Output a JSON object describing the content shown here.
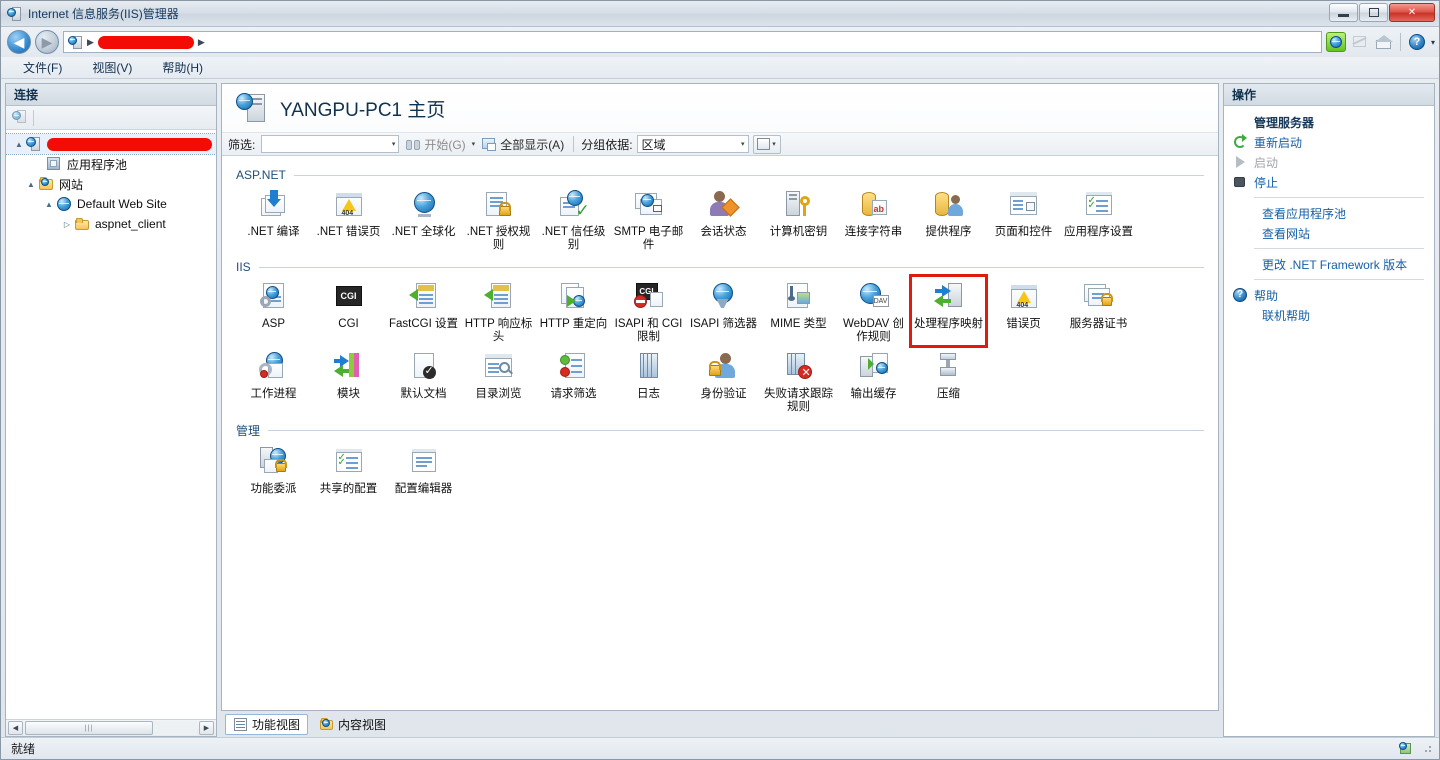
{
  "window": {
    "title": "Internet 信息服务(IIS)管理器",
    "app_icon": "iis-server-icon",
    "minimize": "—",
    "maximize": "□",
    "close": "✕"
  },
  "addressbar": {
    "back_icon": "back-arrow-icon",
    "forward_icon": "forward-arrow-icon",
    "back_glyph": "◀",
    "forward_glyph": "▶",
    "crumb_icon": "server-icon",
    "crumb_sep": "▶",
    "crumb_redacted": "",
    "refresh_icon": "refresh-icon",
    "stop_icon": "stop-icon",
    "home_icon": "home-icon",
    "help_icon": "help-icon",
    "help_caret": "▾"
  },
  "menubar": {
    "items": [
      {
        "label": "文件(F)"
      },
      {
        "label": "视图(V)"
      },
      {
        "label": "帮助(H)"
      }
    ]
  },
  "sidebar": {
    "header": "连接",
    "toolbar_icon": "connect-to-server-icon",
    "tree": [
      {
        "label": "",
        "redacted": true,
        "indent": 0,
        "expander": "▲",
        "icon": "server-icon",
        "selected": true
      },
      {
        "label": "应用程序池",
        "redacted": false,
        "indent": 1,
        "expander": "",
        "icon": "app-pool-icon",
        "selected": false
      },
      {
        "label": "网站",
        "redacted": false,
        "indent": 1,
        "expander": "▲",
        "icon": "sites-folder-icon",
        "selected": false
      },
      {
        "label": "Default Web Site",
        "redacted": false,
        "indent": 2,
        "expander": "▲",
        "icon": "website-globe-icon",
        "selected": false
      },
      {
        "label": "aspnet_client",
        "redacted": false,
        "indent": 3,
        "expander": "▷",
        "icon": "folder-icon",
        "selected": false
      }
    ],
    "scroll_left": "◀",
    "scroll_right": "▶",
    "scroll_thumb": "|||"
  },
  "main": {
    "page_title": "YANGPU-PC1 主页",
    "page_title_icon": "server-home-icon",
    "filter": {
      "label": "筛选:",
      "value": "",
      "placeholder": "",
      "caret": "▾",
      "start_label": "开始(G)",
      "start_icon": "binoculars-icon",
      "start_caret": "▾",
      "showall_label": "全部显示(A)",
      "showall_icon": "show-all-icon",
      "groupby_label": "分组依据:",
      "groupby_value": "区域",
      "viewmode_icon": "view-mode-icon",
      "viewmode_caret": "▾"
    },
    "groups": [
      {
        "title": "ASP.NET",
        "items": [
          {
            "label": ".NET 编译",
            "icon": "net-compile-icon"
          },
          {
            "label": ".NET 错误页",
            "icon": "net-error-pages-icon"
          },
          {
            "label": ".NET 全球化",
            "icon": "net-globalization-icon"
          },
          {
            "label": ".NET 授权规则",
            "icon": "net-authorization-rules-icon"
          },
          {
            "label": ".NET 信任级别",
            "icon": "net-trust-levels-icon"
          },
          {
            "label": "SMTP 电子邮件",
            "icon": "smtp-email-icon"
          },
          {
            "label": "会话状态",
            "icon": "session-state-icon"
          },
          {
            "label": "计算机密钥",
            "icon": "machine-key-icon"
          },
          {
            "label": "连接字符串",
            "icon": "connection-strings-icon"
          },
          {
            "label": "提供程序",
            "icon": "providers-icon"
          },
          {
            "label": "页面和控件",
            "icon": "pages-and-controls-icon"
          },
          {
            "label": "应用程序设置",
            "icon": "application-settings-icon"
          }
        ]
      },
      {
        "title": "IIS",
        "items": [
          {
            "label": "ASP",
            "icon": "asp-icon"
          },
          {
            "label": "CGI",
            "icon": "cgi-icon"
          },
          {
            "label": "FastCGI 设置",
            "icon": "fastcgi-settings-icon"
          },
          {
            "label": "HTTP 响应标头",
            "icon": "http-response-headers-icon"
          },
          {
            "label": "HTTP 重定向",
            "icon": "http-redirect-icon"
          },
          {
            "label": "ISAPI 和 CGI 限制",
            "icon": "isapi-cgi-restrictions-icon"
          },
          {
            "label": "ISAPI 筛选器",
            "icon": "isapi-filters-icon"
          },
          {
            "label": "MIME 类型",
            "icon": "mime-types-icon"
          },
          {
            "label": "WebDAV 创作规则",
            "icon": "webdav-authoring-rules-icon"
          },
          {
            "label": "处理程序映射",
            "icon": "handler-mappings-icon",
            "highlighted": true
          },
          {
            "label": "错误页",
            "icon": "error-pages-icon"
          },
          {
            "label": "服务器证书",
            "icon": "server-certificates-icon"
          },
          {
            "label": "工作进程",
            "icon": "worker-processes-icon"
          },
          {
            "label": "模块",
            "icon": "modules-icon"
          },
          {
            "label": "默认文档",
            "icon": "default-document-icon"
          },
          {
            "label": "目录浏览",
            "icon": "directory-browsing-icon"
          },
          {
            "label": "请求筛选",
            "icon": "request-filtering-icon"
          },
          {
            "label": "日志",
            "icon": "logging-icon"
          },
          {
            "label": "身份验证",
            "icon": "authentication-icon"
          },
          {
            "label": "失败请求跟踪规则",
            "icon": "failed-request-tracing-rules-icon"
          },
          {
            "label": "输出缓存",
            "icon": "output-caching-icon"
          },
          {
            "label": "压缩",
            "icon": "compression-icon"
          }
        ]
      },
      {
        "title": "管理",
        "items": [
          {
            "label": "功能委派",
            "icon": "feature-delegation-icon"
          },
          {
            "label": "共享的配置",
            "icon": "shared-configuration-icon"
          },
          {
            "label": "配置编辑器",
            "icon": "configuration-editor-icon"
          }
        ]
      }
    ],
    "view_tabs": [
      {
        "label": "功能视图",
        "icon": "features-view-icon",
        "active": true
      },
      {
        "label": "内容视图",
        "icon": "content-view-icon",
        "active": false
      }
    ]
  },
  "actions": {
    "header": "操作",
    "items": [
      {
        "label": "管理服务器",
        "type": "header",
        "icon": ""
      },
      {
        "label": "重新启动",
        "type": "link",
        "icon": "restart-icon"
      },
      {
        "label": "启动",
        "type": "link-disabled",
        "icon": "play-icon"
      },
      {
        "label": "停止",
        "type": "link",
        "icon": "stop-square-icon"
      },
      {
        "label": "divider",
        "type": "divider",
        "icon": ""
      },
      {
        "label": "查看应用程序池",
        "type": "link-indent",
        "icon": ""
      },
      {
        "label": "查看网站",
        "type": "link-indent",
        "icon": ""
      },
      {
        "label": "divider",
        "type": "divider",
        "icon": ""
      },
      {
        "label": "更改 .NET Framework 版本",
        "type": "link-indent",
        "icon": ""
      },
      {
        "label": "divider",
        "type": "divider",
        "icon": ""
      },
      {
        "label": "帮助",
        "type": "link",
        "icon": "help-circle-icon"
      },
      {
        "label": "联机帮助",
        "type": "link-indent",
        "icon": ""
      }
    ]
  },
  "statusbar": {
    "text": "就绪",
    "icon": "config-status-icon",
    "grip": "resize-grip"
  },
  "colors": {
    "accent": "#1560a8",
    "highlight_box": "#e01a0d",
    "redaction": "#f30c06",
    "title_text": "#11324e"
  }
}
